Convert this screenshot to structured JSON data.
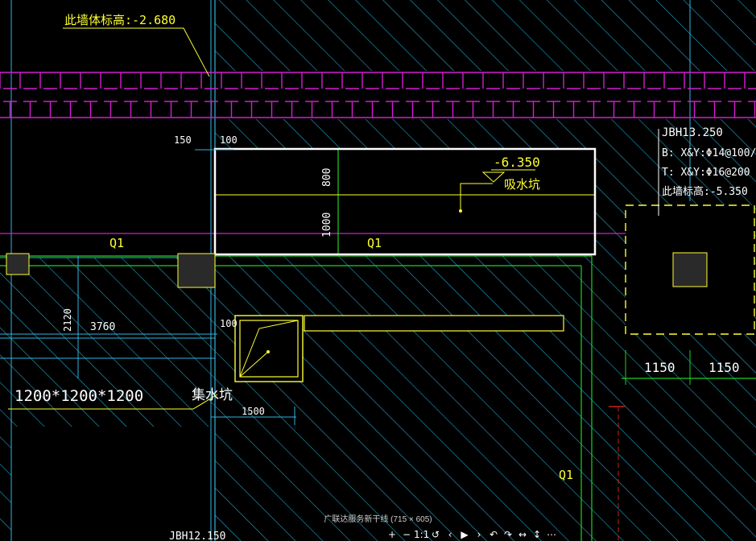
{
  "drawing": {
    "wall_elevation_note": "此墙体标高:-2.680",
    "dim_150": "150",
    "dim_100_top": "100",
    "dim_800": "800",
    "dim_1000": "1000",
    "elevation_sump": "-6.350",
    "sump_label": "吸水坑",
    "q1_left": "Q1",
    "q1_mid": "Q1",
    "q1_bottom_right": "Q1",
    "dim_2120": "2120",
    "dim_3760": "3760",
    "dim_100_mid": "100",
    "pit_size": "1200*1200*1200",
    "collection_pit_label": "集水坑",
    "dim_1500": "1500",
    "jbh_top": "JBH13.250",
    "jbh_b": "B: X&Y:Φ14@100/",
    "jbh_t": "T: X&Y:Φ16@200",
    "jbh_elev": "此墙标高:-5.350",
    "dim_1150_a": "1150",
    "dim_1150_b": "1150",
    "jbh_bottom": "JBH12.150"
  },
  "viewer": {
    "caption": "广联达服务新干线 (715 × 605)",
    "toolbar": [
      "+",
      "−",
      "1:1",
      "↺",
      "‹",
      "▶",
      "›",
      "↶",
      "↷",
      "↔",
      "↕",
      "⋯"
    ]
  },
  "colors": {
    "background": "#000000",
    "hatch": "#1fa3c8",
    "magenta": "#d01fd0",
    "yellow": "#ffff33",
    "green": "#20d020",
    "cyan": "#2fb6e0",
    "white": "#ffffff"
  }
}
